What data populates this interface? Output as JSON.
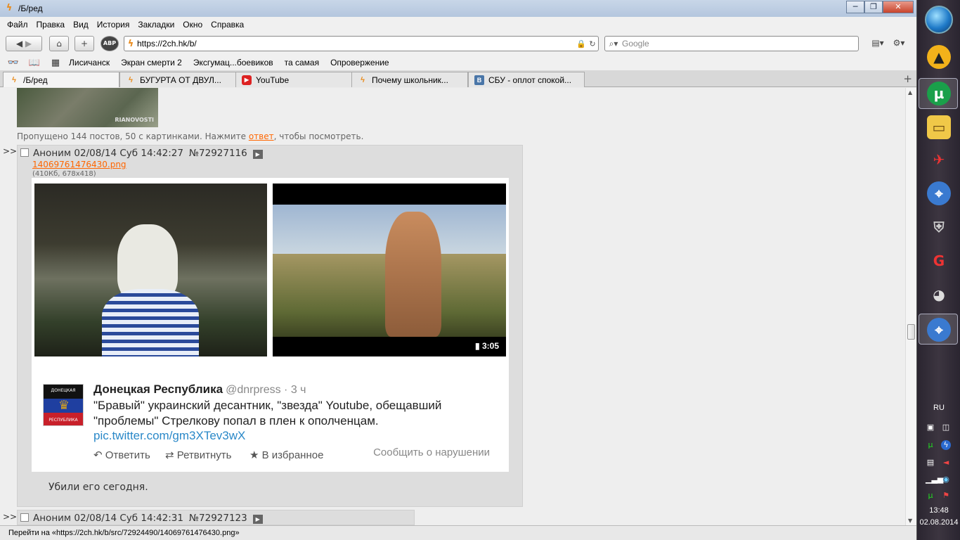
{
  "window": {
    "title": "/Б/ред",
    "minimize": "─",
    "maximize": "❐",
    "close": "✕"
  },
  "menu": [
    "Файл",
    "Правка",
    "Вид",
    "История",
    "Закладки",
    "Окно",
    "Справка"
  ],
  "nav": {
    "url": "https://2ch.hk/b/",
    "search_placeholder": "Google"
  },
  "bookmarks": [
    "Лисичанск",
    "Экран смерти 2",
    "Эксгумац...боевиков",
    "та самая",
    "Опровержение"
  ],
  "tabs": [
    {
      "label": "/Б/ред",
      "icon": "2ch-icon",
      "active": true
    },
    {
      "label": "БУГУРТА ОТ ДВУЛ...",
      "icon": "2ch-icon",
      "active": false
    },
    {
      "label": "YouTube",
      "icon": "youtube-icon",
      "active": false
    },
    {
      "label": "Почему школьник...",
      "icon": "2ch-icon",
      "active": false
    },
    {
      "label": "СБУ - оплот спокой...",
      "icon": "vk-icon",
      "active": false
    }
  ],
  "thread": {
    "top_image_watermark": "RIANOVOSTI",
    "omitted_prefix": "Пропущено 144 постов, 50 с картинками. Нажмите ",
    "omitted_link": "ответ",
    "omitted_suffix": ", чтобы посмотреть.",
    "post": {
      "marker": ">>",
      "author_date": "Аноним 02/08/14 Суб 14:42:27",
      "number": "№72927116",
      "file_name": "14069761476430.png",
      "file_meta": "(410Кб, 678x418)",
      "video_time": "3:05",
      "tweet": {
        "name": "Донецкая Республика",
        "handle": "@dnrpress · 3 ч",
        "text": "\"Бравый\" украинский десантник, \"звезда\" Youtube, обещавший \"проблемы\" Стрелкову попал в плен к ополченцам.",
        "link": "pic.twitter.com/gm3XTev3wX",
        "reply": "Ответить",
        "retweet": "Ретвитнуть",
        "favorite": "В избранное",
        "report": "Сообщить о нарушении",
        "avatar_top": "ДОНЕЦКАЯ",
        "avatar_bottom": "РЕСПУБЛИКА"
      },
      "message": "Убили его сегодня."
    },
    "next_post": {
      "marker": ">>",
      "author_date": "Аноним 02/08/14 Суб 14:42:31",
      "number": "№72927123"
    }
  },
  "status": "Перейти на «https://2ch.hk/b/src/72924490/14069761476430.png»",
  "taskbar": {
    "lang": "RU",
    "time": "13:48",
    "date": "02.08.2014"
  }
}
